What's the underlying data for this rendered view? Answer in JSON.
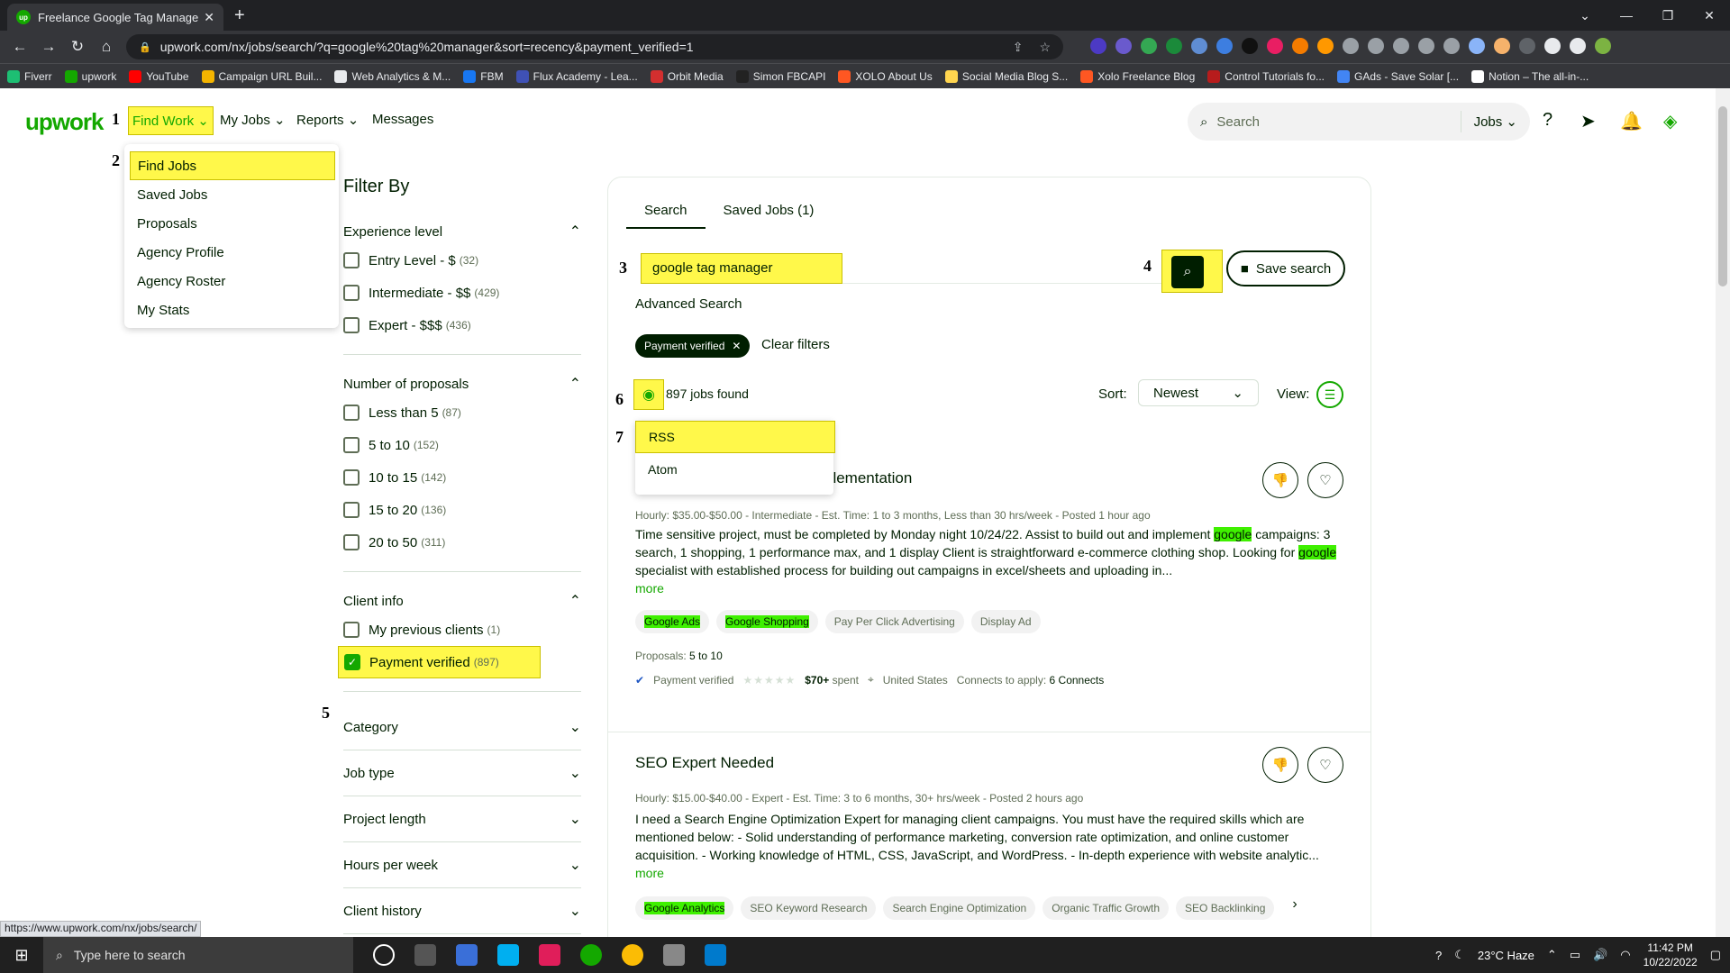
{
  "browser": {
    "tab_title": "Freelance Google Tag Manager J...",
    "url": "upwork.com/nx/jobs/search/?q=google%20tag%20manager&sort=recency&payment_verified=1",
    "bookmarks": [
      "Fiverr",
      "upwork",
      "YouTube",
      "Campaign URL Buil...",
      "Web Analytics & M...",
      "FBM",
      "Flux Academy - Lea...",
      "Orbit Media",
      "Simon FBCAPI",
      "XOLO About Us",
      "Social Media Blog S...",
      "Xolo Freelance Blog",
      "Control Tutorials fo...",
      "GAds - Save Solar [...",
      "Notion – The all-in-..."
    ],
    "status_url": "https://www.upwork.com/nx/jobs/search/"
  },
  "header": {
    "logo": "upwork",
    "nav": [
      "Find Work",
      "My Jobs",
      "Reports",
      "Messages"
    ],
    "search_placeholder": "Search",
    "search_scope": "Jobs"
  },
  "annotations": [
    "1",
    "2",
    "3",
    "4",
    "5",
    "6",
    "7"
  ],
  "find_work_menu": [
    "Find Jobs",
    "Saved Jobs",
    "Proposals",
    "Agency Profile",
    "Agency Roster",
    "My Stats"
  ],
  "filters": {
    "title": "Filter By",
    "experience": {
      "label": "Experience level",
      "options": [
        {
          "label": "Entry Level - $",
          "count": "(32)"
        },
        {
          "label": "Intermediate - $$",
          "count": "(429)"
        },
        {
          "label": "Expert - $$$",
          "count": "(436)"
        }
      ]
    },
    "proposals": {
      "label": "Number of proposals",
      "options": [
        {
          "label": "Less than 5",
          "count": "(87)"
        },
        {
          "label": "5 to 10",
          "count": "(152)"
        },
        {
          "label": "10 to 15",
          "count": "(142)"
        },
        {
          "label": "15 to 20",
          "count": "(136)"
        },
        {
          "label": "20 to 50",
          "count": "(311)"
        }
      ]
    },
    "client_info": {
      "label": "Client info",
      "options": [
        {
          "label": "My previous clients",
          "count": "(1)"
        },
        {
          "label": "Payment verified",
          "count": "(897)"
        }
      ]
    },
    "collapsed": [
      "Category",
      "Job type",
      "Project length",
      "Hours per week",
      "Client history"
    ]
  },
  "main": {
    "tabs": [
      "Search",
      "Saved Jobs (1)"
    ],
    "query": "google tag manager",
    "save_search": "Save search",
    "advanced": "Advanced Search",
    "chip": "Payment verified",
    "clear": "Clear filters",
    "found": "897 jobs found",
    "sort_label": "Sort:",
    "sort_value": "Newest",
    "view_label": "View:",
    "feed_menu": [
      "RSS",
      "Atom"
    ]
  },
  "jobs": [
    {
      "title_visible": "plementation",
      "meta": "Hourly: $35.00-$50.00 - Intermediate - Est. Time: 1 to 3 months, Less than 30 hrs/week - Posted 1 hour ago",
      "desc_1": "Time sensitive project, must be completed by Monday night 10/24/22. Assist to build out and implement ",
      "desc_hl1": "google",
      "desc_2": " campaigns: 3 search, 1 shopping, 1 performance max, and 1 display Client is straightforward e-commerce clothing shop. Looking for ",
      "desc_hl2": "google",
      "desc_3": " specialist with established process for building out campaigns in excel/sheets and uploading in...",
      "more": "more",
      "skills": [
        "Google Ads",
        "Google Shopping",
        "Pay Per Click Advertising",
        "Display Ad"
      ],
      "proposals_label": "Proposals:",
      "proposals_value": "5 to 10",
      "payment": "Payment verified",
      "spent": "$70+",
      "spent_suffix": "spent",
      "location": "United States",
      "connects": "Connects to apply:",
      "connects_value": "6 Connects"
    },
    {
      "title": "SEO Expert Needed",
      "meta": "Hourly: $15.00-$40.00 - Expert - Est. Time: 3 to 6 months, 30+ hrs/week - Posted 2 hours ago",
      "desc": "I need a Search Engine Optimization Expert for managing client campaigns. You must have the required skills which are mentioned below: - Solid understanding of performance marketing, conversion rate optimization, and online customer acquisition. - Working knowledge of HTML, CSS, JavaScript, and WordPress. - In-depth experience with website analytic...",
      "more": "more",
      "skills": [
        "Google Analytics",
        "SEO Keyword Research",
        "Search Engine Optimization",
        "Organic Traffic Growth",
        "SEO Backlinking"
      ]
    }
  ],
  "taskbar": {
    "search": "Type here to search",
    "weather": "23°C  Haze",
    "time": "11:42 PM",
    "date": "10/22/2022"
  }
}
